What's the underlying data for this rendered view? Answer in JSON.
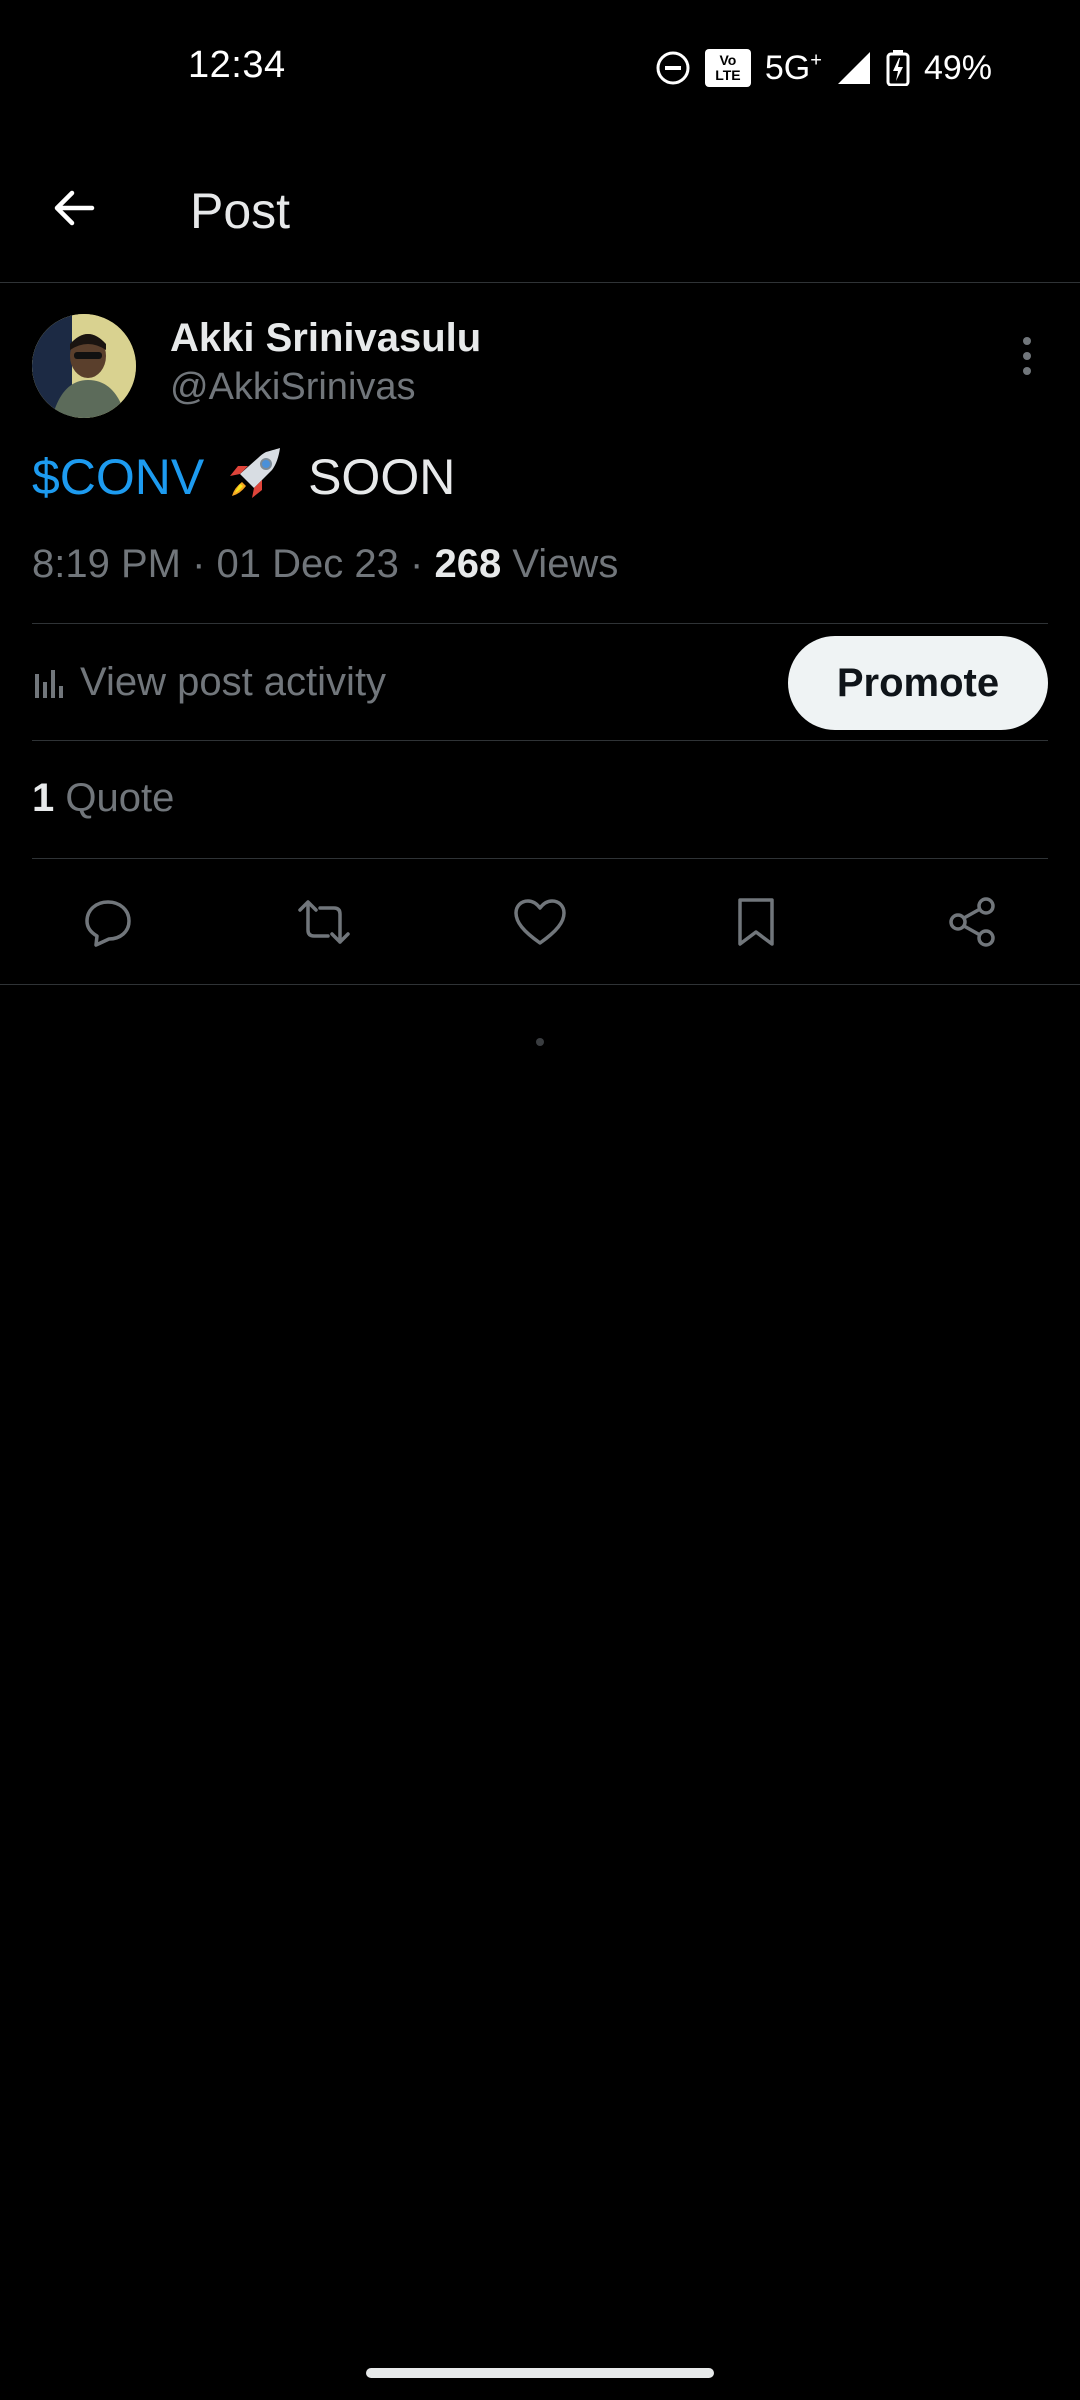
{
  "status_bar": {
    "time": "12:34",
    "volte_top": "Vo",
    "volte_bottom": "LTE",
    "network": "5G",
    "network_suffix": "+",
    "battery": "49%",
    "icons": [
      "do-not-disturb-icon",
      "volte-icon",
      "signal-icon",
      "battery-charging-icon"
    ]
  },
  "header": {
    "title": "Post",
    "back_icon": "arrow-left-icon"
  },
  "post": {
    "author_name": "Akki Srinivasulu",
    "author_handle": "@AkkiSrinivas",
    "text_cashtag": "$CONV",
    "text_emoji": "rocket-emoji",
    "text_rest": "SOON",
    "time": "8:19 PM",
    "date": "01 Dec 23",
    "views_count": "268",
    "views_label": "Views",
    "separator": "·"
  },
  "activity": {
    "label": "View post activity",
    "icon": "bar-chart-icon",
    "promote_label": "Promote"
  },
  "quotes": {
    "count": "1",
    "label": "Quote"
  },
  "actions": [
    "reply-icon",
    "repost-icon",
    "like-icon",
    "bookmark-icon",
    "share-icon"
  ],
  "colors": {
    "background": "#000000",
    "primary_text": "#e7e9ea",
    "secondary_text": "#71767b",
    "accent": "#1d9bf0",
    "divider": "#2f3336",
    "promote_bg": "#eff3f4"
  }
}
